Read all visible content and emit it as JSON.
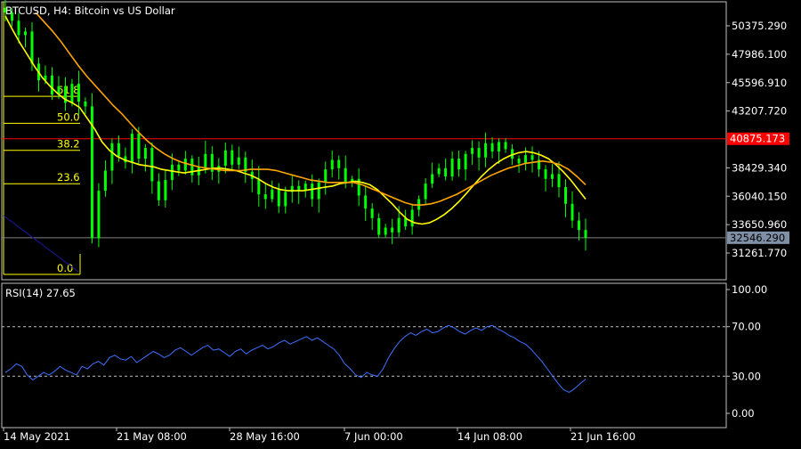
{
  "window": {
    "title": "BTCUSD, H4: Bitcoin vs US Dollar"
  },
  "colors": {
    "background": "#000000",
    "frame": "#c0c0c0",
    "text": "#ffffff",
    "candle": "#00ff00",
    "ma_fast": "#ffff00",
    "ma_slow": "#ffa500",
    "fibo": "#ffff00",
    "resistance_line": "#ff0000",
    "bid_line": "#808080",
    "bid_label_bg": "#7f8fa6",
    "rsi_line": "#3f6fff",
    "trend_line": "#1a1aa0"
  },
  "chart_data": [
    {
      "type": "candlestick",
      "title": "BTCUSD, H4: Bitcoin vs US Dollar",
      "x_tick_labels": [
        "14 May 2021",
        "21 May 08:00",
        "28 May 16:00",
        "7 Jun 00:00",
        "14 Jun 08:00",
        "21 Jun 16:00"
      ],
      "y_tick_labels": [
        "50375.290",
        "47986.100",
        "45596.910",
        "43207.720",
        "38429.340",
        "36040.150",
        "33650.960",
        "31261.770"
      ],
      "ylim": [
        30000,
        52000
      ],
      "close_series_approx": [
        51500,
        50800,
        49600,
        49900,
        47200,
        45800,
        46200,
        44600,
        45300,
        43900,
        45500,
        44000,
        43600,
        32500,
        36500,
        38200,
        40500,
        39400,
        38900,
        41300,
        39200,
        40100,
        37300,
        35700,
        37400,
        38700,
        38200,
        39200,
        37800,
        38500,
        39600,
        38100,
        38600,
        39900,
        38700,
        39300,
        38100,
        37500,
        36200,
        35800,
        36600,
        35200,
        36400,
        36900,
        36500,
        37100,
        35800,
        37200,
        38300,
        39100,
        38400,
        37200,
        37500,
        36100,
        35000,
        34200,
        32800,
        33400,
        33000,
        34200,
        33500,
        34900,
        35800,
        37100,
        37900,
        38400,
        37700,
        39200,
        38300,
        39600,
        40100,
        39300,
        40500,
        39800,
        40600,
        40000,
        39200,
        38800,
        39500,
        39100,
        38300,
        37500,
        37900,
        36800,
        35400,
        34000,
        33200,
        32546
      ],
      "moving_averages": [
        {
          "name": "MA fast",
          "color_key": "ma_fast",
          "values": [
            51200,
            50000,
            48900,
            47900,
            46900,
            46000,
            45300,
            44700,
            44200,
            43900,
            43500,
            42600,
            41700,
            40600,
            39900,
            39400,
            39100,
            38900,
            38700,
            38600,
            38500,
            38300,
            38200,
            38100,
            38000,
            38100,
            38200,
            38300,
            38400,
            38400,
            38300,
            38200,
            38000,
            37800,
            37500,
            37100,
            36800,
            36600,
            36500,
            36500,
            36500,
            36600,
            36700,
            36800,
            36900,
            37100,
            37200,
            37300,
            37200,
            37000,
            36600,
            36000,
            35400,
            34700,
            34100,
            33800,
            33700,
            33800,
            34100,
            34500,
            35000,
            35600,
            36300,
            37000,
            37700,
            38300,
            38800,
            39200,
            39500,
            39700,
            39800,
            39700,
            39500,
            39200,
            38700,
            38100,
            37400,
            36600,
            35800
          ]
        },
        {
          "name": "MA slow",
          "color_key": "ma_slow",
          "values": [
            51500,
            50700,
            49900,
            49000,
            48000,
            47000,
            46100,
            45300,
            44500,
            43700,
            43000,
            42200,
            41400,
            40700,
            40100,
            39600,
            39200,
            38900,
            38700,
            38500,
            38400,
            38300,
            38200,
            38200,
            38200,
            38300,
            38300,
            38300,
            38200,
            38000,
            37800,
            37600,
            37400,
            37300,
            37200,
            37200,
            37200,
            37200,
            37000,
            36700,
            36400,
            36100,
            35800,
            35500,
            35300,
            35300,
            35400,
            35600,
            35900,
            36200,
            36600,
            37000,
            37400,
            37800,
            38100,
            38400,
            38600,
            38800,
            38900,
            39000,
            38900,
            38700,
            38300,
            37700,
            37000
          ]
        }
      ],
      "fibonacci_levels": [
        "61.8",
        "50.0",
        "38.2",
        "23.6",
        "0.0"
      ],
      "horizontal_lines": [
        {
          "label": "40875.173",
          "color_key": "resistance_line"
        },
        {
          "label": "32546.290",
          "color_key": "bid_line"
        }
      ]
    },
    {
      "type": "line",
      "title": "RSI(14) 27.65",
      "y_tick_labels": [
        "100.00",
        "70.00",
        "30.00",
        "0.00"
      ],
      "ylim": [
        0,
        100
      ],
      "levels": [
        70,
        30
      ],
      "values": [
        33,
        36,
        40,
        38,
        31,
        27,
        30,
        33,
        31,
        34,
        38,
        35,
        33,
        31,
        38,
        36,
        40,
        42,
        39,
        45,
        47,
        44,
        43,
        46,
        41,
        44,
        47,
        50,
        48,
        45,
        47,
        51,
        53,
        50,
        47,
        50,
        53,
        55,
        51,
        52,
        49,
        46,
        50,
        52,
        48,
        51,
        53,
        55,
        52,
        54,
        57,
        59,
        56,
        58,
        60,
        62,
        59,
        61,
        58,
        55,
        52,
        47,
        40,
        36,
        31,
        29,
        33,
        31,
        30,
        36,
        45,
        52,
        58,
        62,
        65,
        63,
        66,
        68,
        65,
        66,
        69,
        71,
        69,
        66,
        64,
        67,
        69,
        67,
        70,
        71,
        68,
        66,
        63,
        61,
        58,
        56,
        52,
        47,
        42,
        36,
        30,
        24,
        19,
        17,
        20,
        24,
        27.65
      ]
    }
  ]
}
